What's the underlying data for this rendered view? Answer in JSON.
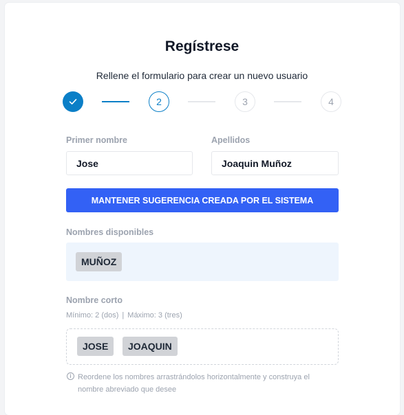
{
  "form": {
    "title": "Regístrese",
    "subtitle": "Rellene el formulario para crear un nuevo usuario"
  },
  "stepper": {
    "steps": [
      {
        "label": "",
        "state": "completed",
        "icon": "check-icon"
      },
      {
        "label": "2",
        "state": "active"
      },
      {
        "label": "3",
        "state": "pending"
      },
      {
        "label": "4",
        "state": "pending"
      }
    ],
    "accent_color": "#0b7fc7"
  },
  "fields": {
    "first_name": {
      "label": "Primer nombre",
      "value": "Jose"
    },
    "last_name": {
      "label": "Apellidos",
      "value": "Joaquin Muñoz"
    }
  },
  "actions": {
    "keep_suggestion_label": "MANTENER SUGERENCIA CREADA POR EL SISTEMA",
    "button_color": "#3361f5"
  },
  "available_names": {
    "label": "Nombres disponibles",
    "chips": [
      "MUÑOZ"
    ]
  },
  "short_name": {
    "label": "Nombre corto",
    "min_text": "Mínimo: 2 (dos)",
    "separator": "|",
    "max_text": "Máximo: 3 (tres)",
    "chips": [
      "JOSE",
      "JOAQUIN"
    ],
    "info_icon": "info-circle-icon",
    "info_text": "Reordene los nombres arrastrándolos horizontalmente y construya el nombre abreviado que desee"
  }
}
